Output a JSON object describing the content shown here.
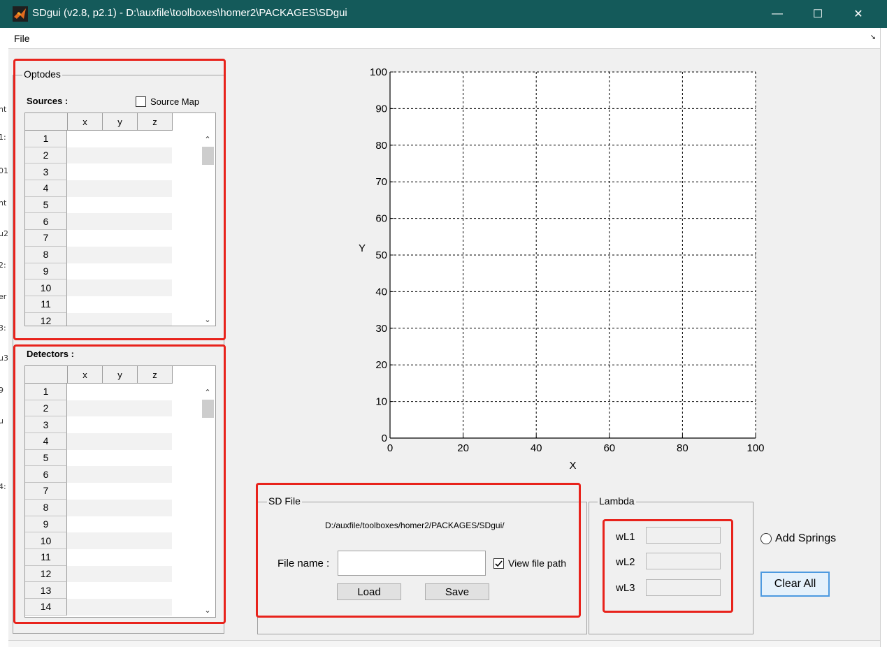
{
  "window": {
    "title": "SDgui  (v2.8, p2.1) - D:\\auxfile\\toolboxes\\homer2\\PACKAGES\\SDgui",
    "minimize": "—",
    "maximize": "☐",
    "close": "✕"
  },
  "menu": {
    "file": "File",
    "corner": "↘"
  },
  "underlying": [
    "nt",
    "1:",
    "01",
    "nt",
    "u2",
    "2:",
    "er",
    "3:",
    "u3",
    "9",
    "u",
    "4:"
  ],
  "optodes": {
    "panel_title": "Optodes",
    "sources": {
      "label": "Sources :",
      "source_map": {
        "label": "Source Map",
        "checked": false
      },
      "columns": [
        "x",
        "y",
        "z"
      ],
      "rows": [
        "1",
        "2",
        "3",
        "4",
        "5",
        "6",
        "7",
        "8",
        "9",
        "10",
        "11",
        "12"
      ]
    },
    "detectors": {
      "label": "Detectors :",
      "columns": [
        "x",
        "y",
        "z"
      ],
      "rows": [
        "1",
        "2",
        "3",
        "4",
        "5",
        "6",
        "7",
        "8",
        "9",
        "10",
        "11",
        "12",
        "13",
        "14"
      ]
    }
  },
  "chart_data": {
    "type": "scatter",
    "title": "",
    "xlabel": "X",
    "ylabel": "Y",
    "xlim": [
      0,
      100
    ],
    "ylim": [
      0,
      100
    ],
    "xticks": [
      0,
      20,
      40,
      60,
      80,
      100
    ],
    "yticks": [
      0,
      10,
      20,
      30,
      40,
      50,
      60,
      70,
      80,
      90,
      100
    ],
    "grid": true,
    "grid_style": "dashed",
    "series": []
  },
  "sd_file": {
    "panel_title": "SD File",
    "path": "D:/auxfile/toolboxes/homer2/PACKAGES/SDgui/",
    "file_name_label": "File name :",
    "file_name_value": "",
    "view_file_path": {
      "label": "View file path",
      "checked": true
    },
    "load_label": "Load",
    "save_label": "Save"
  },
  "lambda": {
    "panel_title": "Lambda",
    "wavelengths": [
      {
        "label": "wL1",
        "value": ""
      },
      {
        "label": "wL2",
        "value": ""
      },
      {
        "label": "wL3",
        "value": ""
      }
    ]
  },
  "add_springs": {
    "label": "Add Springs",
    "checked": false
  },
  "clear_all_label": "Clear All",
  "colors": {
    "titlebar": "#145a5a",
    "highlight": "#e8231c",
    "panel_bg": "#f0f0f0"
  }
}
